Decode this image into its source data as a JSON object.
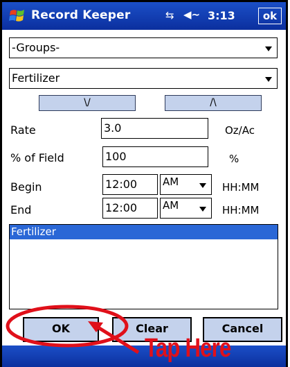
{
  "title_bar": {
    "app_title": "Record Keeper",
    "connectivity_icon": "connectivity-icon",
    "volume_icon": "volume-icon",
    "time": "3:13",
    "ok_label": "ok"
  },
  "groups_dropdown": {
    "value": "-Groups-"
  },
  "type_dropdown": {
    "value": "Fertilizer"
  },
  "nav_buttons": {
    "down_label": "\\/",
    "up_label": "/\\"
  },
  "form": {
    "rate": {
      "label": "Rate",
      "value": "3.0",
      "unit": "Oz/Ac"
    },
    "field": {
      "label": "% of Field",
      "value": "100",
      "unit": "%"
    },
    "begin": {
      "label": "Begin",
      "time": "12:00",
      "ampm": "AM",
      "format": "HH:MM"
    },
    "end": {
      "label": "End",
      "time": "12:00",
      "ampm": "AM",
      "format": "HH:MM"
    }
  },
  "list": {
    "items": [
      "Fertilizer"
    ]
  },
  "buttons": {
    "ok": "OK",
    "clear": "Clear",
    "cancel": "Cancel"
  },
  "annotation": {
    "text": "Tap Here",
    "color": "#e0101a"
  },
  "colors": {
    "title_bar": "#0b2f9e",
    "button": "#c4d2ec",
    "selection": "#2a67d6"
  }
}
